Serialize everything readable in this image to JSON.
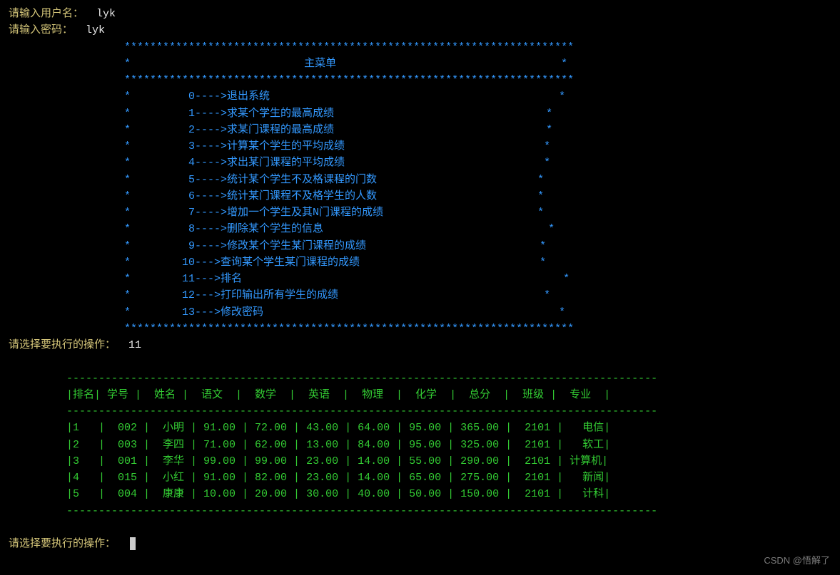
{
  "login": {
    "username_prompt": "请输入用户名：",
    "username_value": "lyk",
    "password_prompt": "请输入密码：",
    "password_value": "lyk"
  },
  "menu_title": "主菜单",
  "menu_items": [
    {
      "num": "0",
      "arrow": "---->",
      "label": "退出系统"
    },
    {
      "num": "1",
      "arrow": "---->",
      "label": "求某个学生的最高成绩"
    },
    {
      "num": "2",
      "arrow": "---->",
      "label": "求某门课程的最高成绩"
    },
    {
      "num": "3",
      "arrow": "---->",
      "label": "计算某个学生的平均成绩"
    },
    {
      "num": "4",
      "arrow": "---->",
      "label": "求出某门课程的平均成绩"
    },
    {
      "num": "5",
      "arrow": "---->",
      "label": "统计某个学生不及格课程的门数"
    },
    {
      "num": "6",
      "arrow": "---->",
      "label": "统计某门课程不及格学生的人数"
    },
    {
      "num": "7",
      "arrow": "---->",
      "label": "增加一个学生及其N门课程的成绩"
    },
    {
      "num": "8",
      "arrow": "---->",
      "label": "删除某个学生的信息"
    },
    {
      "num": "9",
      "arrow": "---->",
      "label": "修改某个学生某门课程的成绩"
    },
    {
      "num": "10",
      "arrow": "--->",
      "label": "查询某个学生某门课程的成绩"
    },
    {
      "num": "11",
      "arrow": "--->",
      "label": "排名"
    },
    {
      "num": "12",
      "arrow": "--->",
      "label": "打印输出所有学生的成绩"
    },
    {
      "num": "13",
      "arrow": "--->",
      "label": "修改密码"
    }
  ],
  "action_prompt": "请选择要执行的操作：",
  "action_value": "11",
  "table": {
    "headers": [
      "排名",
      "学号",
      "姓名",
      "语文",
      "数学",
      "英语",
      "物理",
      "化学",
      "总分",
      "班级",
      "专业"
    ],
    "rows": [
      {
        "rank": "1",
        "id": "002",
        "name": "小明",
        "chinese": "91.00",
        "math": "72.00",
        "english": "43.00",
        "physics": "64.00",
        "chemistry": "95.00",
        "total": "365.00",
        "class": "2101",
        "major": "电信"
      },
      {
        "rank": "2",
        "id": "003",
        "name": "李四",
        "chinese": "71.00",
        "math": "62.00",
        "english": "13.00",
        "physics": "84.00",
        "chemistry": "95.00",
        "total": "325.00",
        "class": "2101",
        "major": "软工"
      },
      {
        "rank": "3",
        "id": "001",
        "name": "李华",
        "chinese": "99.00",
        "math": "99.00",
        "english": "23.00",
        "physics": "14.00",
        "chemistry": "55.00",
        "total": "290.00",
        "class": "2101",
        "major": "计算机"
      },
      {
        "rank": "4",
        "id": "015",
        "name": "小红",
        "chinese": "91.00",
        "math": "82.00",
        "english": "23.00",
        "physics": "14.00",
        "chemistry": "65.00",
        "total": "275.00",
        "class": "2101",
        "major": "新闻"
      },
      {
        "rank": "5",
        "id": "004",
        "name": "康康",
        "chinese": "10.00",
        "math": "20.00",
        "english": "30.00",
        "physics": "40.00",
        "chemistry": "50.00",
        "total": "150.00",
        "class": "2101",
        "major": "计科"
      }
    ]
  },
  "watermark": "CSDN @悟解了"
}
